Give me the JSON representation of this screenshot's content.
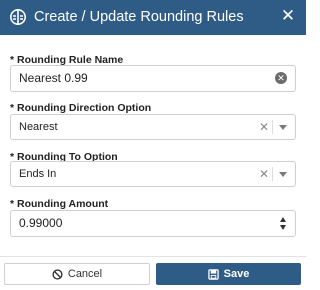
{
  "dialog": {
    "title": "Create / Update Rounding Rules",
    "title_icon": "rounding-rules-icon",
    "close_icon": "close-icon",
    "header_color": "#2e5c86"
  },
  "fields": {
    "rule_name": {
      "label": "* Rounding Rule Name",
      "value": "Nearest 0.99",
      "clear_icon": "clear-circle-icon"
    },
    "direction": {
      "label": "* Rounding Direction Option",
      "value": "Nearest",
      "clear_icon": "clear-icon",
      "dropdown_icon": "chevron-down-icon"
    },
    "to_option": {
      "label": "* Rounding To Option",
      "value": "Ends In",
      "clear_icon": "clear-icon",
      "dropdown_icon": "chevron-down-icon"
    },
    "amount": {
      "label": "* Rounding Amount",
      "value": "0.99000",
      "stepper_icons": [
        "spin-up-icon",
        "spin-down-icon"
      ]
    }
  },
  "footer": {
    "cancel_label": "Cancel",
    "cancel_icon": "ban-icon",
    "save_label": "Save",
    "save_icon": "save-icon",
    "save_color": "#2e5c86"
  }
}
